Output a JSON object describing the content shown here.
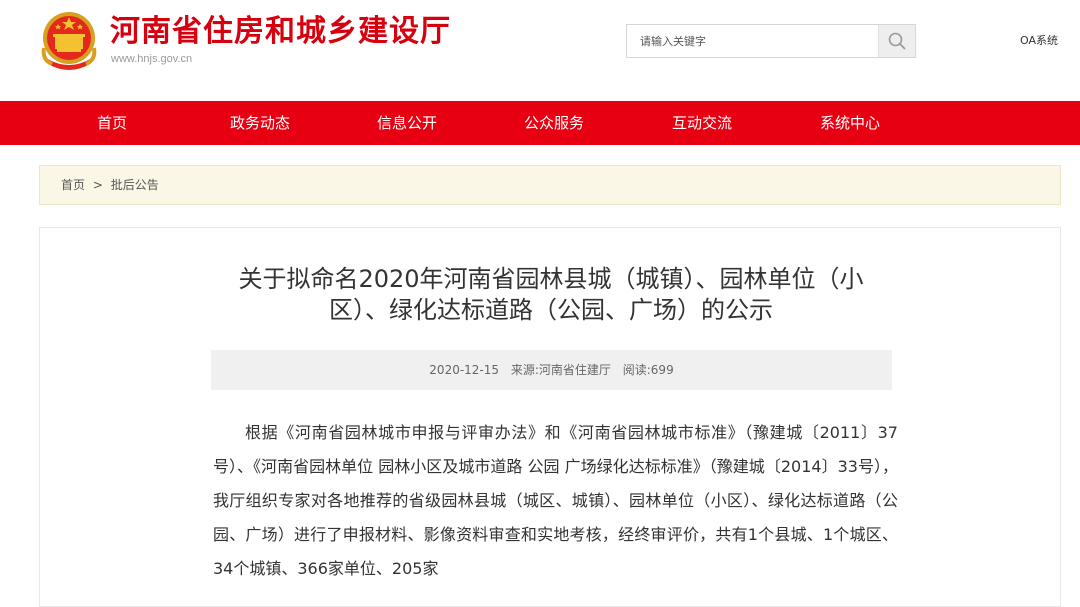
{
  "header": {
    "site_title": "河南省住房和城乡建设厅",
    "site_url": "www.hnjs.gov.cn",
    "search_placeholder": "请输入关键字",
    "oa_label": "OA系统"
  },
  "nav": {
    "items": [
      {
        "label": "首页"
      },
      {
        "label": "政务动态"
      },
      {
        "label": "信息公开"
      },
      {
        "label": "公众服务"
      },
      {
        "label": "互动交流"
      },
      {
        "label": "系统中心"
      }
    ]
  },
  "breadcrumb": {
    "home": "首页",
    "separator": ">",
    "current": "批后公告"
  },
  "article": {
    "title": "关于拟命名2020年河南省园林县城（城镇）、园林单位（小区）、绿化达标道路（公园、广场）的公示",
    "date": "2020-12-15",
    "source": "来源:河南省住建厅",
    "views": "阅读:699",
    "body": "根据《河南省园林城市申报与评审办法》和《河南省园林城市标准》（豫建城〔2011〕37号）、《河南省园林单位 园林小区及城市道路 公园 广场绿化达标标准》（豫建城〔2014〕33号），我厅组织专家对各地推荐的省级园林县城（城区、城镇）、园林单位（小区）、绿化达标道路（公园、广场）进行了申报材料、影像资料审查和实地考核，经终审评价，共有1个县城、1个城区、34个城镇、366家单位、205家"
  },
  "colors": {
    "brand_red": "#e60012",
    "title_red": "#d7000f",
    "breadcrumb_bg": "#fbf7e6"
  },
  "icons": {
    "emblem": "national-emblem-icon",
    "search": "search-icon"
  }
}
